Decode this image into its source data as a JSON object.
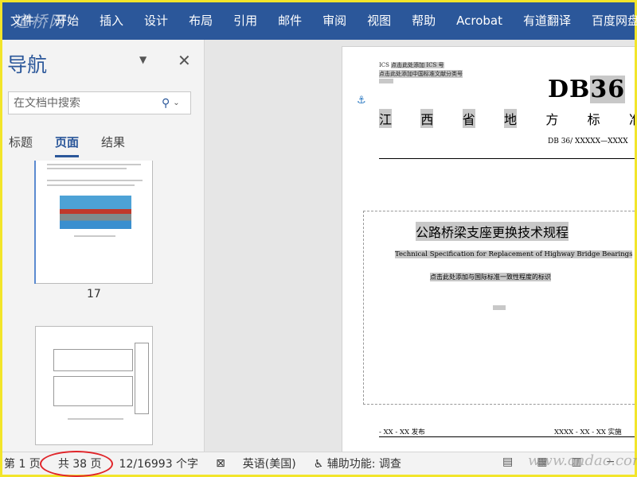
{
  "ribbon": {
    "tabs": [
      "文件",
      "开始",
      "插入",
      "设计",
      "布局",
      "引用",
      "邮件",
      "审阅",
      "视图",
      "帮助",
      "Acrobat",
      "有道翻译",
      "百度网盘"
    ],
    "logo_text": "道桥网"
  },
  "nav": {
    "title": "导航",
    "search_placeholder": "在文档中搜索",
    "tabs": [
      "标题",
      "页面",
      "结果"
    ],
    "active_tab": "页面",
    "thumb_page_label": "17",
    "icons": {
      "dropdown": "chevron-down-icon",
      "close": "close-icon",
      "search": "search-icon"
    }
  },
  "document": {
    "ics": "ICS",
    "ics_hint": "点击此处添加 ICS 号",
    "clc_hint": "点击此处添加中国标准文献分类号",
    "db_prefix": "DB",
    "db_number": "36",
    "province_chars": [
      "江",
      "西",
      "省",
      "地",
      "方",
      "标",
      "准"
    ],
    "std_number": "DB 36/ XXXXX—XXXX",
    "cn_title": "公路桥梁支座更换技术规程",
    "en_title": "Technical Specification for Replacement of Highway Bridge Bearings",
    "intl_hint": "点击此处添加与国际标准一致性程度的标识",
    "issue_text": "- XX - XX 发布",
    "impl_text": "XXXX - XX - XX 实施"
  },
  "status": {
    "page": "第 1 页",
    "total": "共 38 页",
    "words": "12/16993 个字",
    "lang": "英语(美国)",
    "accessibility": "辅助功能: 调查",
    "watermark": "www.cndao.com"
  },
  "colors": {
    "accent": "#2b579a",
    "highlight": "#c8c8c8",
    "circle": "#e0252a"
  }
}
